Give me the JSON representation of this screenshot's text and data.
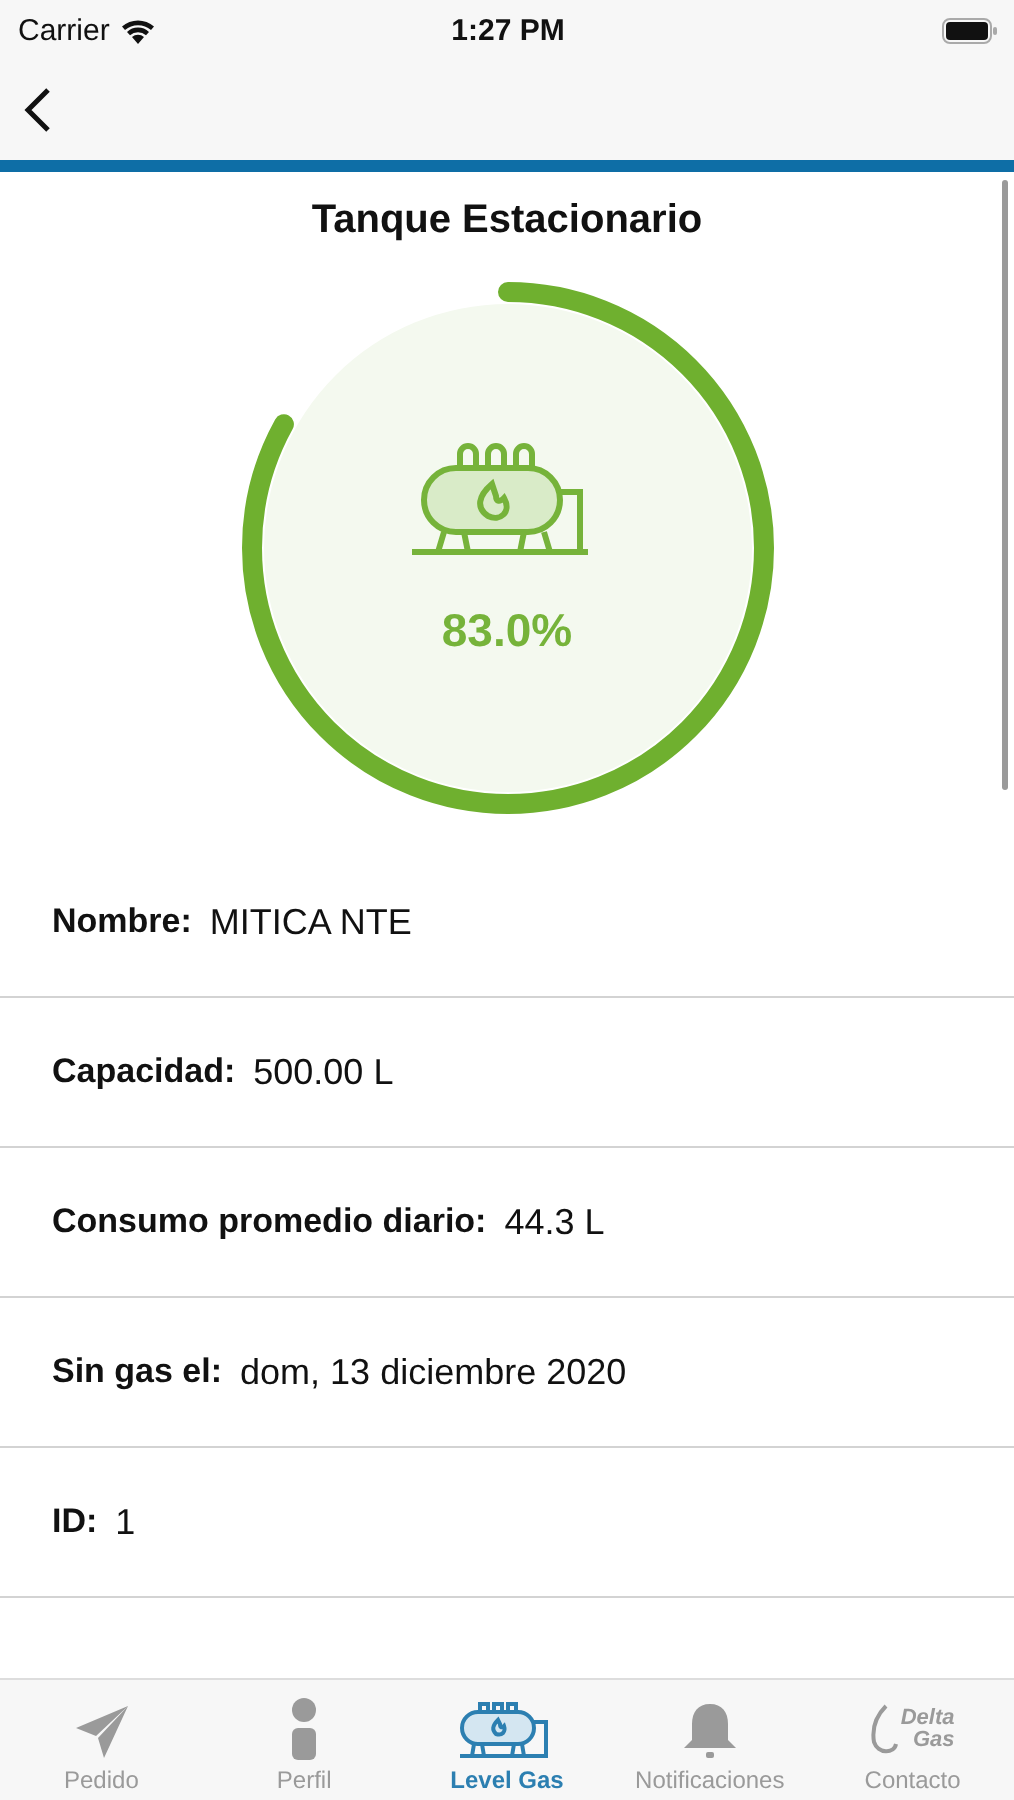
{
  "status_bar": {
    "carrier": "Carrier",
    "time": "1:27 PM"
  },
  "title": "Tanque Estacionario",
  "gauge": {
    "level": 0.83,
    "reading": "83.0%"
  },
  "details": [
    {
      "label": "Nombre:",
      "value": "MITICA NTE"
    },
    {
      "label": "Capacidad:",
      "value": "500.00 L"
    },
    {
      "label": "Consumo promedio diario:",
      "value": "44.3 L"
    },
    {
      "label": "Sin gas el:",
      "value": "dom, 13 diciembre 2020"
    },
    {
      "label": "ID:",
      "value": "1"
    }
  ],
  "tab_bar": [
    {
      "kind": "send",
      "label": "Pedido",
      "selected": false
    },
    {
      "kind": "profile",
      "label": "Perfil",
      "selected": false
    },
    {
      "kind": "tank",
      "label": "Level Gas",
      "selected": true
    },
    {
      "kind": "bell",
      "label": "Notificaciones",
      "selected": false
    },
    {
      "kind": "logo",
      "label": "Contacto",
      "selected": false,
      "logo_text": [
        "Delta",
        "Gas"
      ]
    }
  ]
}
